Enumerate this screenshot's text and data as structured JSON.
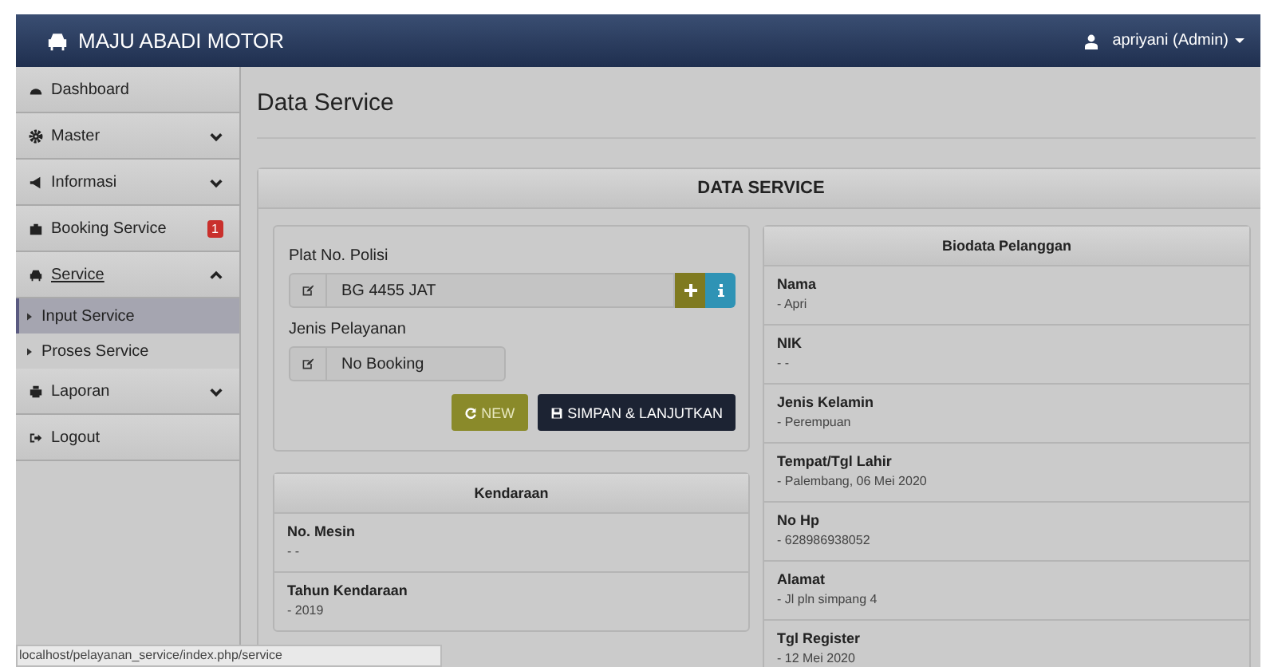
{
  "navbar": {
    "brand": "MAJU ABADI MOTOR",
    "user": "apriyani (Admin)"
  },
  "sidebar": {
    "items": [
      {
        "kind": "link",
        "label": "Dashboard"
      },
      {
        "kind": "group",
        "label": "Master",
        "expanded": false
      },
      {
        "kind": "group",
        "label": "Informasi",
        "expanded": false
      },
      {
        "kind": "badge",
        "label": "Booking Service",
        "badge": "1"
      },
      {
        "kind": "group",
        "label": "Service",
        "expanded": true,
        "children": [
          {
            "label": "Input Service",
            "selected": true
          },
          {
            "label": "Proses Service",
            "selected": false
          }
        ]
      },
      {
        "kind": "group",
        "label": "Laporan",
        "expanded": false
      },
      {
        "kind": "link",
        "label": "Logout"
      }
    ]
  },
  "page": {
    "title": "Data Service"
  },
  "panel": {
    "title": "DATA SERVICE",
    "form": {
      "fields": [
        {
          "label": "Plat No. Polisi",
          "value": "BG 4455 JAT",
          "addons": true
        },
        {
          "label": "Jenis Pelayanan",
          "value": "No Booking",
          "addons": false
        }
      ],
      "buttons": [
        {
          "kind": "new",
          "label": "NEW"
        },
        {
          "kind": "save",
          "label": "SIMPAN & LANJUTKAN"
        }
      ]
    },
    "vehicle": {
      "title": "Kendaraan",
      "rows": [
        {
          "label": "No. Mesin",
          "value": "- -"
        },
        {
          "label": "Tahun Kendaraan",
          "value": "- 2019"
        }
      ]
    },
    "customer": {
      "title": "Biodata Pelanggan",
      "rows": [
        {
          "label": "Nama",
          "value": "- Apri"
        },
        {
          "label": "NIK",
          "value": "- -"
        },
        {
          "label": "Jenis Kelamin",
          "value": "- Perempuan"
        },
        {
          "label": "Tempat/Tgl Lahir",
          "value": "- Palembang, 06 Mei 2020"
        },
        {
          "label": "No Hp",
          "value": "- 628986938052"
        },
        {
          "label": "Alamat",
          "value": "- Jl pln simpang 4"
        },
        {
          "label": "Tgl Register",
          "value": "- 12 Mei 2020"
        }
      ]
    }
  },
  "status_bar": {
    "url": "localhost/pelayanan_service/index.php/service"
  }
}
